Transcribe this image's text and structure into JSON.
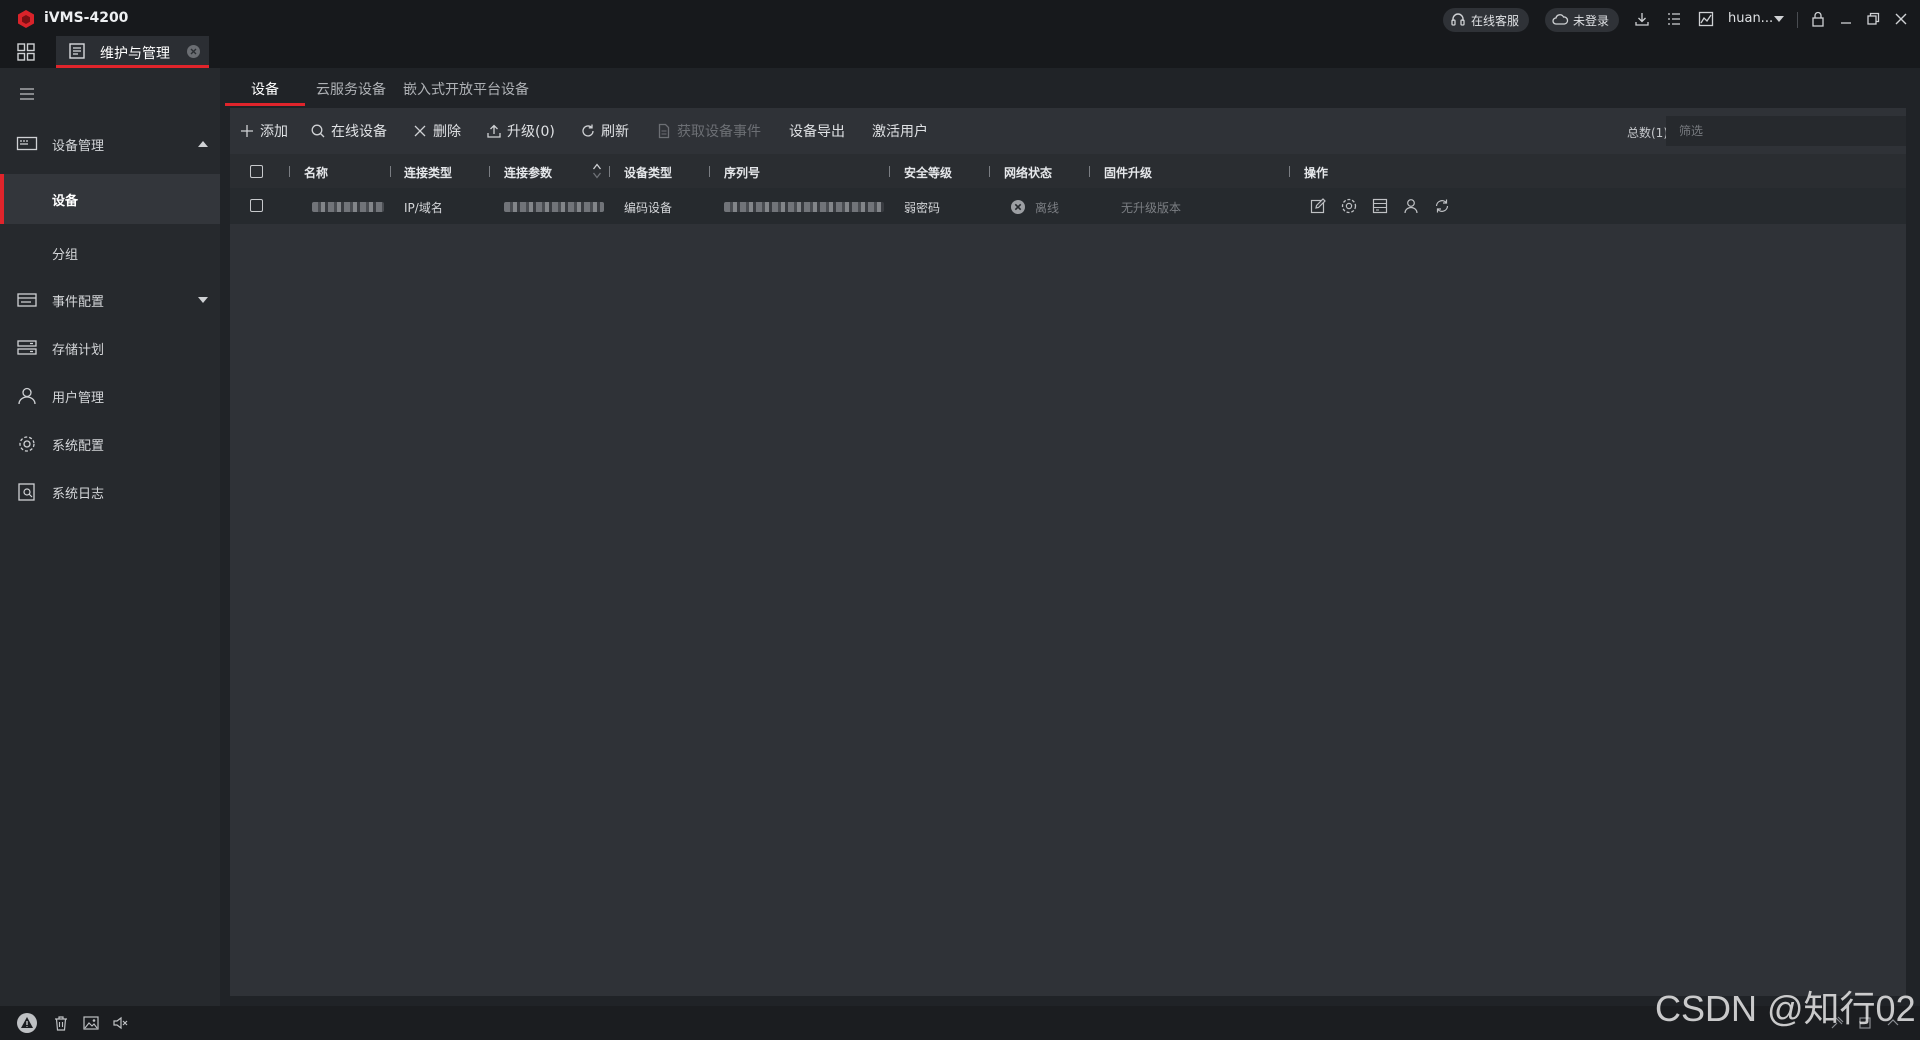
{
  "app": {
    "title": "iVMS-4200"
  },
  "titlebar": {
    "online_service": "在线客服",
    "not_logged_in": "未登录",
    "username": "huan..."
  },
  "tab": {
    "label": "维护与管理"
  },
  "sidebar": {
    "items": [
      {
        "label": "设备管理"
      },
      {
        "label": "设备"
      },
      {
        "label": "分组"
      },
      {
        "label": "事件配置"
      },
      {
        "label": "存储计划"
      },
      {
        "label": "用户管理"
      },
      {
        "label": "系统配置"
      },
      {
        "label": "系统日志"
      }
    ]
  },
  "subtabs": [
    {
      "label": "设备"
    },
    {
      "label": "云服务设备"
    },
    {
      "label": "嵌入式开放平台设备"
    }
  ],
  "toolbar": {
    "add": "添加",
    "online_devices": "在线设备",
    "delete": "删除",
    "upgrade": "升级(0)",
    "refresh": "刷新",
    "get_events": "获取设备事件",
    "export": "设备导出",
    "activate_user": "激活用户",
    "total": "总数(1)",
    "filter_placeholder": "筛选"
  },
  "table": {
    "columns": [
      "名称",
      "连接类型",
      "连接参数",
      "设备类型",
      "序列号",
      "安全等级",
      "网络状态",
      "固件升级",
      "操作"
    ],
    "rows": [
      {
        "connection_type": "IP/域名",
        "device_type": "编码设备",
        "security_level": "弱密码",
        "network_status": "离线",
        "firmware": "无升级版本"
      }
    ]
  },
  "watermark": "CSDN @知行02",
  "colors": {
    "accent": "#e0242b",
    "background": "#202327",
    "sidebar": "#26292d"
  }
}
